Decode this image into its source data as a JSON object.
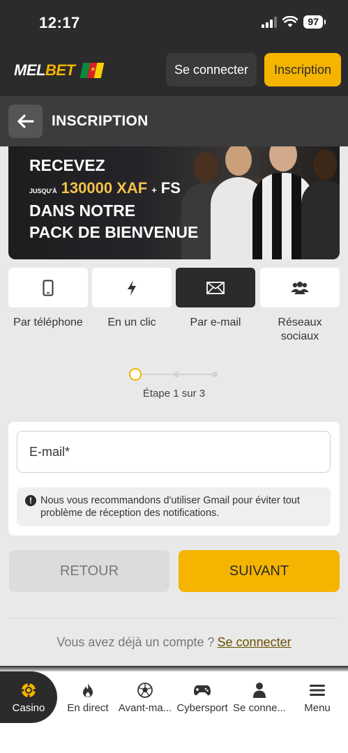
{
  "status_bar": {
    "time": "12:17",
    "battery": "97"
  },
  "header": {
    "logo_main": "MEL",
    "logo_accent": "BET",
    "login_label": "Se connecter",
    "register_label": "Inscription"
  },
  "page": {
    "title": "INSCRIPTION"
  },
  "banner": {
    "line1": "RECEVEZ",
    "small": "JUSQU'À",
    "amount": "130000 XAF",
    "plus": "+",
    "fs": "FS",
    "line3": "DANS NOTRE",
    "line4": "PACK DE BIENVENUE"
  },
  "methods": [
    {
      "label": "Par téléphone",
      "icon": "phone-icon"
    },
    {
      "label": "En un clic",
      "icon": "lightning-icon"
    },
    {
      "label": "Par e-mail",
      "icon": "envelope-icon",
      "active": true
    },
    {
      "label": "Réseaux sociaux",
      "icon": "users-icon"
    }
  ],
  "stepper": {
    "text": "Étape 1 sur 3",
    "current": 1,
    "total": 3
  },
  "form": {
    "email_placeholder": "E-mail*",
    "hint": "Nous vous recommandons d'utiliser Gmail pour éviter tout problème de réception des notifications."
  },
  "actions": {
    "back_label": "RETOUR",
    "next_label": "SUIVANT"
  },
  "footer": {
    "question": "Vous avez déjà un compte ?",
    "login_link": "Se connecter"
  },
  "bottom_nav": [
    {
      "label": "Casino",
      "icon": "casino-chip-icon",
      "active": true
    },
    {
      "label": "En direct",
      "icon": "flame-icon"
    },
    {
      "label": "Avant-ma...",
      "icon": "soccer-ball-icon"
    },
    {
      "label": "Cybersport",
      "icon": "gamepad-icon"
    },
    {
      "label": "Se conne...",
      "icon": "user-icon"
    },
    {
      "label": "Menu",
      "icon": "hamburger-icon"
    }
  ],
  "colors": {
    "accent": "#f5b400",
    "dark": "#2b2b2b",
    "page_bg": "#e9e9ea"
  }
}
